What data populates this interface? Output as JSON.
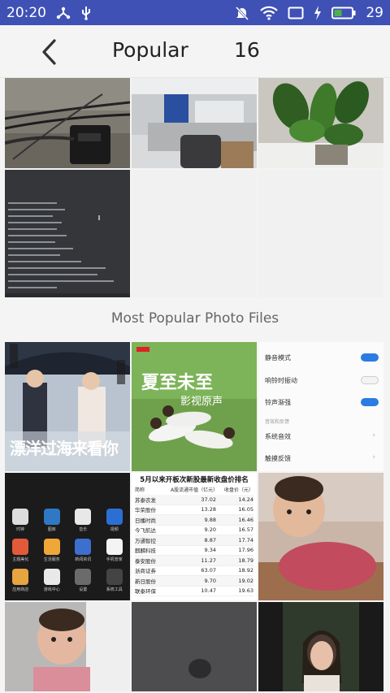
{
  "status": {
    "time": "20:20",
    "battery": "29"
  },
  "header": {
    "title": "Popular",
    "count": "16"
  },
  "section": {
    "label": "Most Popular Photo Files"
  },
  "settings_thumb": {
    "items": [
      "静音模式",
      "响铃时振动",
      "铃声渐强",
      "音效和反馈",
      "系统音效",
      "触摸反馈"
    ]
  },
  "chart_thumb": {
    "title": "5月以来开板次新股最新收盘价排名",
    "headers": [
      "简称",
      "A股流通市值（亿元）",
      "收盘价（元）"
    ],
    "rows": [
      [
        "苏泰农发",
        "37.02",
        "14.24"
      ],
      [
        "华荣股份",
        "13.28",
        "16.05"
      ],
      [
        "日播时尚",
        "9.88",
        "16.46"
      ],
      [
        "今飞航达",
        "9.20",
        "16.57"
      ],
      [
        "万通智控",
        "8.87",
        "17.74"
      ],
      [
        "麒麟科技",
        "9.34",
        "17.96"
      ],
      [
        "泰安股份",
        "11.27",
        "18.79"
      ],
      [
        "浙商证券",
        "63.07",
        "18.92"
      ],
      [
        "新日股份",
        "9.70",
        "19.02"
      ],
      [
        "联泰环保",
        "10.47",
        "19.63"
      ]
    ]
  },
  "movie_thumb": {
    "title": "漂洋过海来看你"
  },
  "green_thumb": {
    "title": "夏至未至",
    "subtitle": "影视原声"
  },
  "apps_thumb": {
    "apps": [
      "时钟",
      "图库",
      "音乐",
      "视频",
      "主题美化",
      "生活服务",
      "新闻资讯",
      "手机管家",
      "应用商店",
      "游戏中心",
      "设置",
      "系统工具"
    ]
  }
}
